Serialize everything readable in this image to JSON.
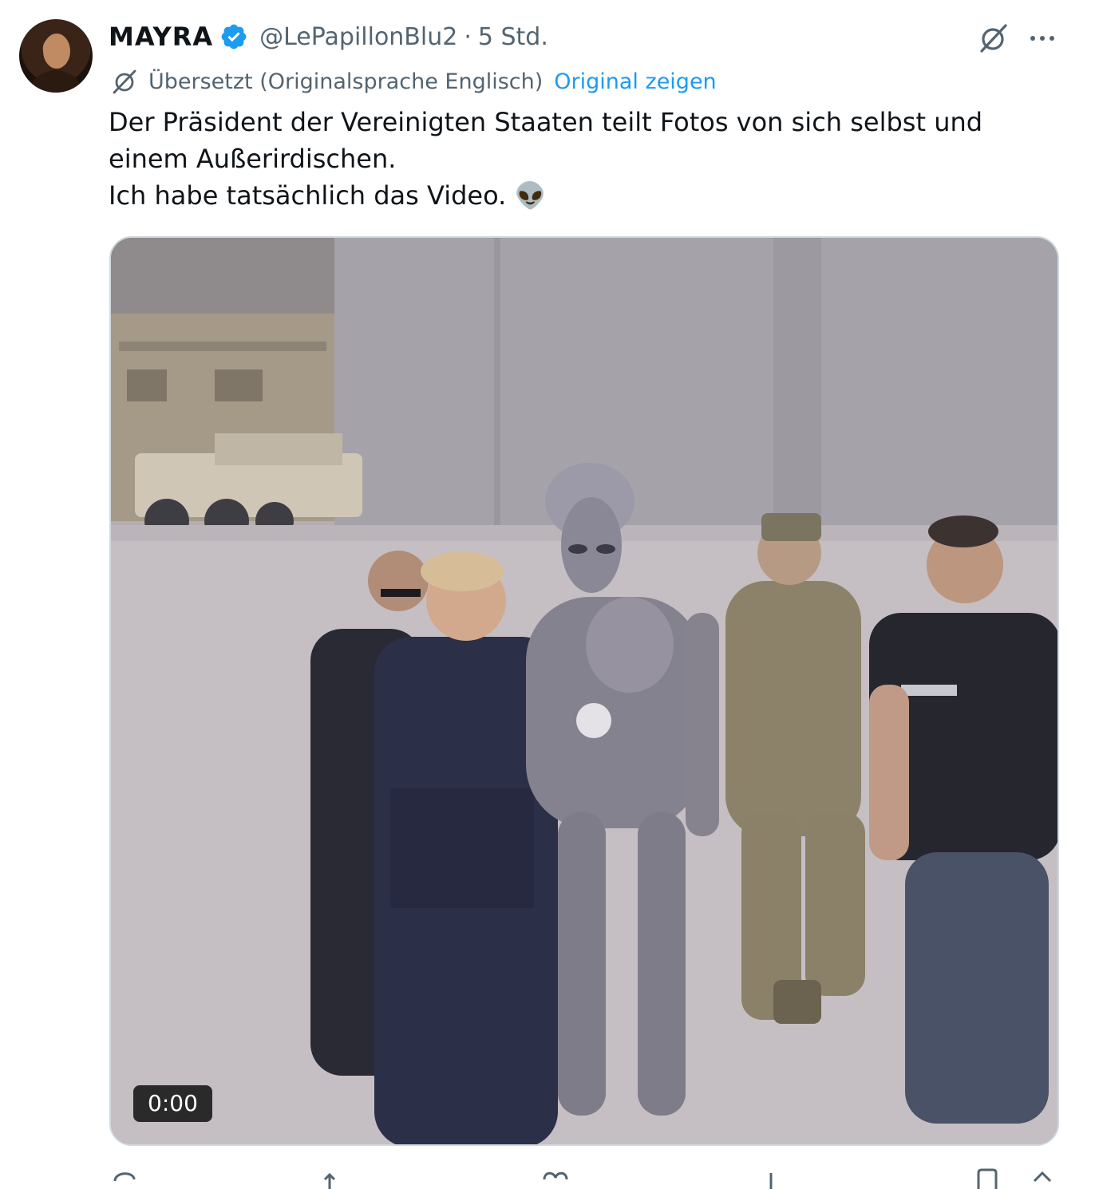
{
  "author": {
    "display_name": "MAYRA",
    "handle": "@LePapillonBlu2",
    "separator": "·",
    "time": "5 Std.",
    "verified": true
  },
  "translation": {
    "label": "Übersetzt (Originalsprache Englisch)",
    "show_original": "Original zeigen"
  },
  "tweet": {
    "line1": "Der Präsident der Vereinigten Staaten teilt Fotos von sich selbst und einem Außerirdischen.",
    "line2": "Ich habe tatsächlich das Video. 👽"
  },
  "media": {
    "type": "video",
    "duration": "0:00"
  },
  "actions": {
    "reply": "",
    "repost": "",
    "like": "",
    "views": ""
  },
  "colors": {
    "accent": "#1d9bf0",
    "text_primary": "#0f1419",
    "text_secondary": "#536471"
  },
  "icons": [
    "verified-badge-icon",
    "grok-icon",
    "more-icon",
    "translate-icon",
    "reply-icon",
    "repost-icon",
    "like-icon",
    "views-icon",
    "bookmark-icon",
    "share-icon"
  ]
}
